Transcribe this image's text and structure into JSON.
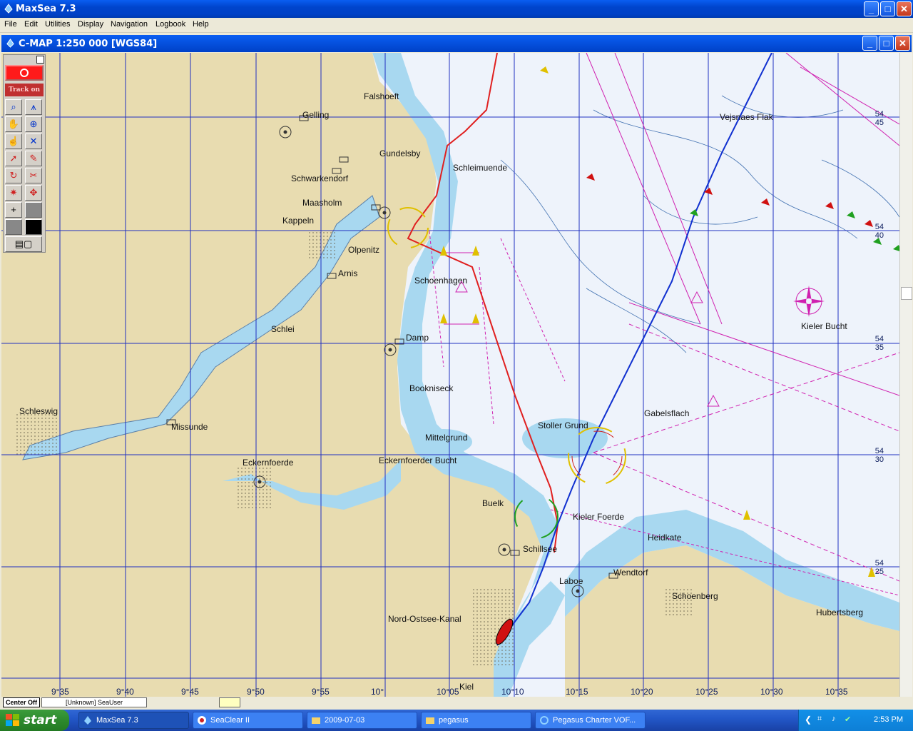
{
  "app": {
    "title": "MaxSea 7.3",
    "menu": [
      "File",
      "Edit",
      "Utilities",
      "Display",
      "Navigation",
      "Logbook",
      "Help"
    ]
  },
  "chart_window": {
    "title": "C-MAP  1:250 000 [WGS84]"
  },
  "toolbar": {
    "track_label": "Track on"
  },
  "place_names": [
    "Gelling",
    "Falshoeft",
    "Gundelsby",
    "Schwarkendorf",
    "Maasholm",
    "Kappeln",
    "Olpenitz",
    "Arnis",
    "Schoenhagen",
    "Schlei",
    "Damp",
    "Schleswig",
    "Missunde",
    "Bookniseck",
    "Mittelgrund",
    "Eckernfoerde",
    "Eckernfoerder Bucht",
    "Buelk",
    "Schillsee",
    "Laboe",
    "Wendtorf",
    "Heidkate",
    "Kieler Foerde",
    "Stoller Grund",
    "Gabelsflach",
    "Kieler Bucht",
    "Vejsnaes Flak",
    "Schoenberg",
    "Hubertsberg",
    "Nord-Ostsee-Kanal",
    "Kiel",
    "Schleimuende"
  ],
  "longitudes": [
    "9°35",
    "9°40",
    "9°45",
    "9°50",
    "9°55",
    "10°",
    "10°05",
    "10°10",
    "10°15",
    "10°20",
    "10°25",
    "10°30",
    "10°35"
  ],
  "latitudes": [
    "54\n45",
    "54\n40",
    "54\n35",
    "54\n30",
    "54\n25"
  ],
  "status": {
    "center": "Center Off",
    "user": "[Unknown] SeaUser"
  },
  "taskbar": {
    "start": "start",
    "tasks": [
      "MaxSea 7.3",
      "SeaClear II",
      "2009-07-03",
      "pegasus",
      "Pegasus Charter VOF..."
    ],
    "clock": "2:53 PM"
  },
  "colors": {
    "land": "#e8dcb0",
    "shallow": "#a8d8f0",
    "deep": "#eef3fb",
    "grid": "#2030c0",
    "track_red": "#e02020",
    "track_blue": "#1030d0",
    "traffic_magenta": "#d020b0"
  }
}
